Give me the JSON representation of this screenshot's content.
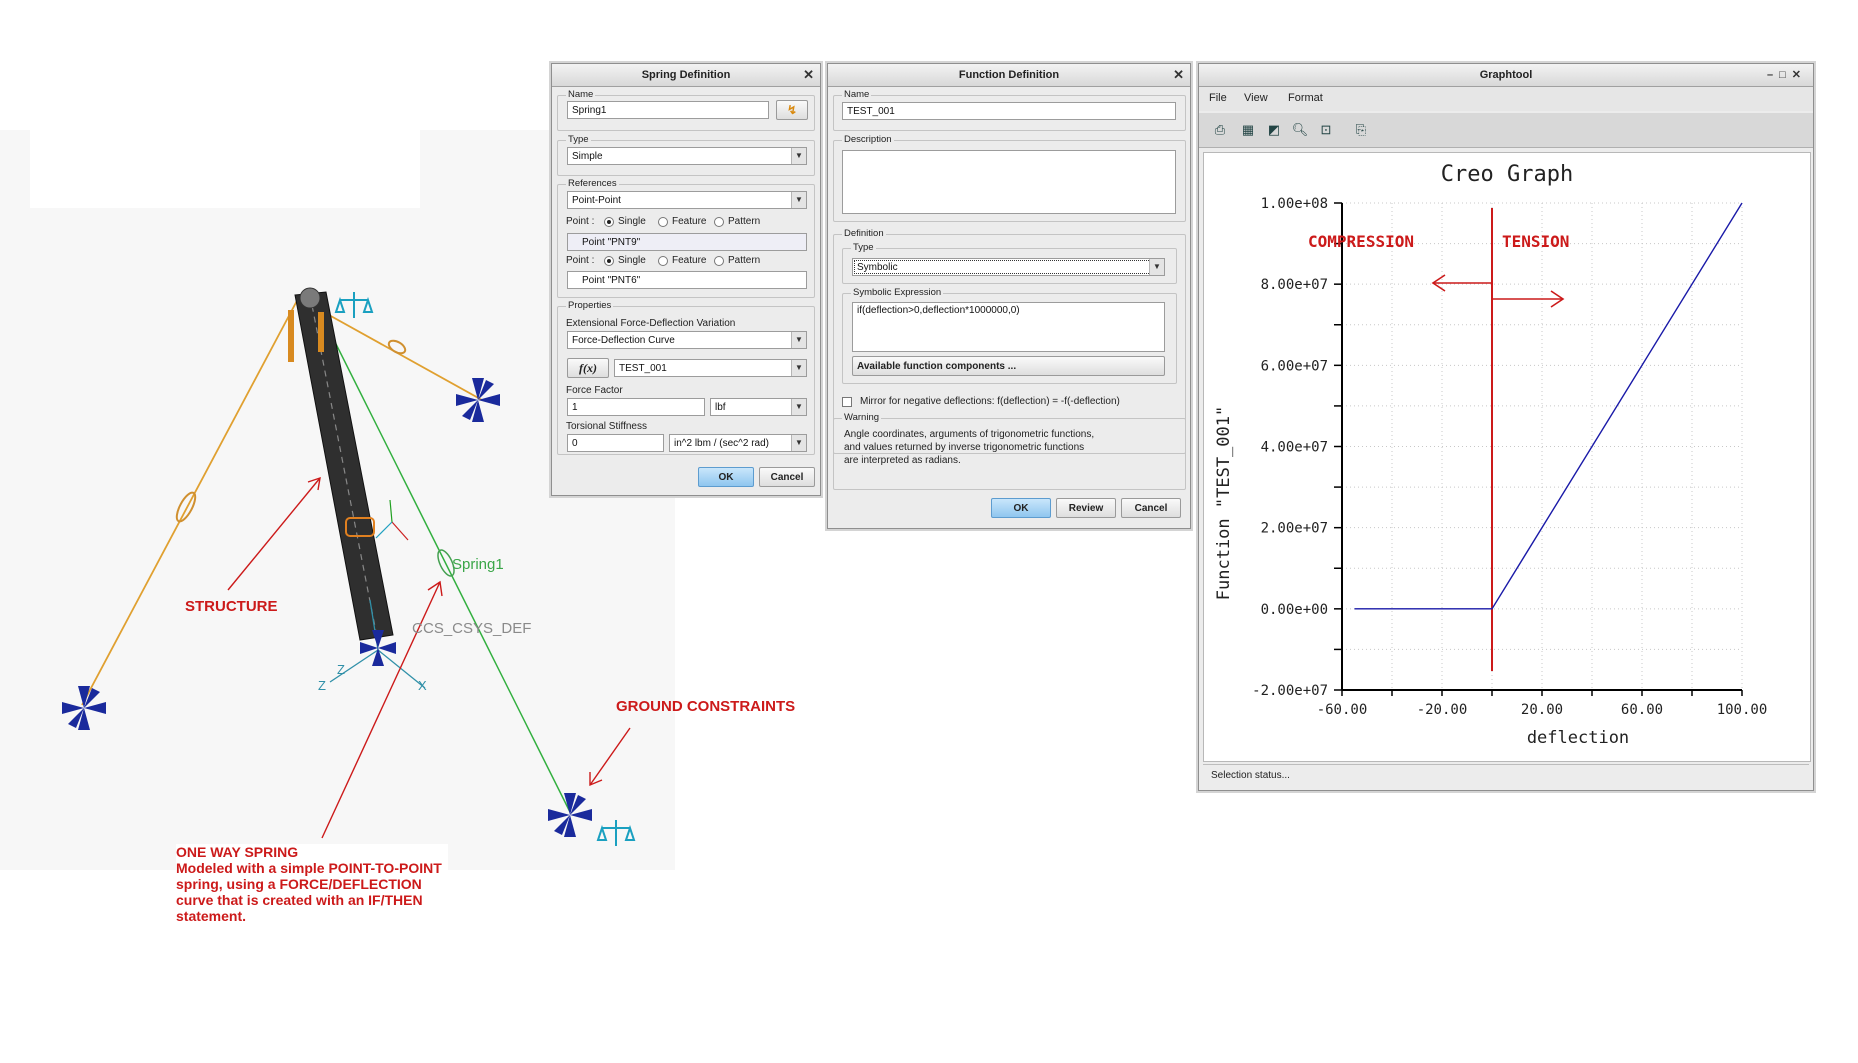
{
  "scene": {
    "spring_label": "Spring1",
    "csys_label": "CS_CSYS_DEF",
    "csys_prefix": "C",
    "axis_x": "X",
    "axis_z": "Z",
    "axis_z2": "Z",
    "annotations": {
      "structure": "STRUCTURE",
      "ground": "GROUND CONSTRAINTS",
      "spring_title": "ONE WAY SPRING",
      "spring_lines": [
        "Modeled with a simple POINT-TO-POINT",
        "spring, using a FORCE/DEFLECTION",
        "curve that is created with an IF/THEN",
        "statement."
      ]
    }
  },
  "spring_dialog": {
    "title": "Spring Definition",
    "name_label": "Name",
    "name_value": "Spring1",
    "type_label": "Type",
    "type_value": "Simple",
    "references_label": "References",
    "references_value": "Point-Point",
    "point_label": "Point :",
    "radio_single": "Single",
    "radio_feature": "Feature",
    "radio_pattern": "Pattern",
    "point1": "Point \"PNT9\"",
    "point2": "Point \"PNT6\"",
    "properties_label": "Properties",
    "ext_label": "Extensional Force-Deflection Variation",
    "ext_value": "Force-Deflection Curve",
    "fx_label": "f(x)",
    "function_value": "TEST_001",
    "force_factor_label": "Force Factor",
    "force_factor_value": "1",
    "force_unit": "lbf",
    "torsional_label": "Torsional Stiffness",
    "torsional_value": "0",
    "torsional_unit": "in^2 lbm / (sec^2 rad)",
    "ok": "OK",
    "cancel": "Cancel"
  },
  "function_dialog": {
    "title": "Function Definition",
    "name_label": "Name",
    "name_value": "TEST_001",
    "description_label": "Description",
    "definition_label": "Definition",
    "type_label": "Type",
    "type_value": "Symbolic",
    "expression_label": "Symbolic Expression",
    "expression_value": "if(deflection>0,deflection*1000000,0)",
    "available_button": "Available function components ...",
    "mirror_label": "Mirror for negative deflections: f(deflection) = -f(-deflection)",
    "warning_label": "Warning",
    "warning_lines": [
      "Angle coordinates, arguments of trigonometric functions,",
      "and values returned by inverse trigonometric functions",
      "are interpreted as radians."
    ],
    "ok": "OK",
    "review": "Review",
    "cancel": "Cancel"
  },
  "graphtool": {
    "title": "Graphtool",
    "menu": [
      "File",
      "View",
      "Format"
    ],
    "status": "Selection status...",
    "compression": "COMPRESSION",
    "tension": "TENSION",
    "icons": [
      "printer-icon",
      "grid-icon",
      "edit-graph-icon",
      "zoom-in-icon",
      "zoom-fit-icon",
      "export-icon"
    ]
  },
  "chart_data": {
    "type": "line",
    "title": "Creo Graph",
    "xlabel": "deflection",
    "ylabel": "Function \"TEST_001\"",
    "xlim": [
      -60,
      100
    ],
    "ylim": [
      -20000000,
      100000000
    ],
    "x_ticks": [
      "-60.00",
      "-20.00",
      "20.00",
      "60.00",
      "100.00"
    ],
    "x_tick_values": [
      -60,
      -20,
      20,
      60,
      100
    ],
    "y_ticks": [
      "1.00e+08",
      "8.00e+07",
      "6.00e+07",
      "4.00e+07",
      "2.00e+07",
      "0.00e+00",
      "-2.00e+07"
    ],
    "y_tick_values": [
      100000000,
      80000000,
      60000000,
      40000000,
      20000000,
      0,
      -20000000
    ],
    "grid": true,
    "series": [
      {
        "x": [
          -100,
          0,
          100
        ],
        "y": [
          0,
          0,
          100000000
        ],
        "color": "#1a1aa8"
      }
    ],
    "marker_line_x": 0,
    "colors": {
      "line": "#1a1aa8",
      "annotation": "#cc1a1a"
    }
  }
}
